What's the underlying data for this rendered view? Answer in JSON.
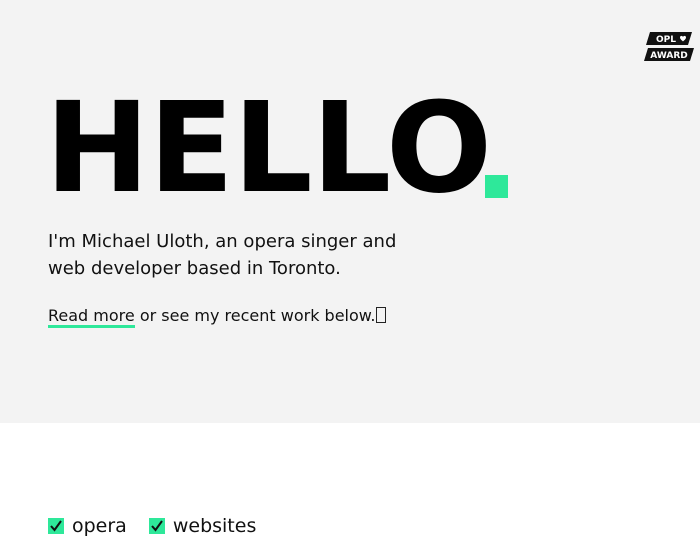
{
  "award": {
    "line1": "OPL",
    "line2": "AWARD",
    "heart_icon": "heart-icon"
  },
  "hero": {
    "headline": "HELLO",
    "intro": "I'm Michael Uloth, an opera singer and web developer based in Toronto.",
    "cta": {
      "link_label": "Read more",
      "rest": " or see my recent work below.",
      "trailing_glyph": "missing-glyph-box"
    },
    "accent_color": "#2ee89a",
    "background": "#f3f3f3"
  },
  "filters": [
    {
      "label": "opera",
      "checked": true
    },
    {
      "label": "websites",
      "checked": true
    }
  ]
}
